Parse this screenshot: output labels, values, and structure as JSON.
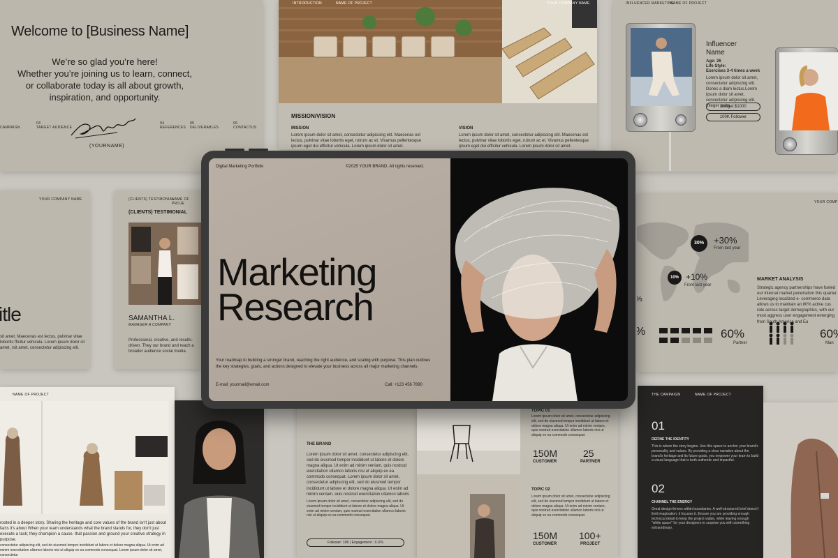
{
  "welcome": {
    "title": "Welcome to [Business Name]",
    "lines": [
      "We’re so glad you’re here!",
      "Whether you’re joining us to learn, connect,",
      "or collaborate  today is all about growth,",
      "inspiration, and opportunity."
    ],
    "signature": "Signature",
    "yourname": "(YOURNAME)",
    "nav": [
      {
        "num": "",
        "label": "CAMPAIGN"
      },
      {
        "num": "03",
        "label": "TARGET AUDIENCE"
      },
      {
        "num": "04",
        "label": "REFERENCES"
      },
      {
        "num": "05",
        "label": "DELIVERABLES"
      },
      {
        "num": "06",
        "label": "CONTACTUS"
      }
    ]
  },
  "mission": {
    "header_left": "INTRODUCTION",
    "header_mid": "NAME OF PROJECT",
    "header_right": "YOUR COMPANY NAME",
    "title": "MISSION/VISION",
    "col1_title": "MISSION",
    "col2_title": "VISION",
    "body": "Lorem ipsum dolor sit amet, consectetur adipiscing elit. Maecenas est lectus, pulvinar vitae lobortis eget, rutrum ac et. Vivamus pellentesque ipsum eget dui efficitur vehicula. Lorem ipsum dolor sit amet."
  },
  "influencer": {
    "header_left": "INFLUENCER MARKETING",
    "header_mid": "NAME OF PROJECT",
    "title": "Influencer Name",
    "age": "Age: 26",
    "lifestyle": "Life Style:",
    "exercise": "Exercises 3-4 times a week",
    "body": "Lorem ipsum dolor sit amet, consectetur adipiscing elit. Donec a diam lectus.Lorem ipsum dolor sit amet, consectetur adipiscing elit. Integer porta.",
    "budget": "Budget:$1000",
    "followers": "100K Follower"
  },
  "company_left": {
    "header": "YOUR COMPANY NAME",
    "title": "itle",
    "body": "sit amet, Maecenas est lectus, pulvinar vitae lobortis fficitur vehicula. Lorem ipsum dolor sit amet, rsit amet, consectetur adipiscing elit."
  },
  "testimonial": {
    "header_left": "(CLIENTS) TESTIMONIAL",
    "header_mid": "NAME OF PROJE",
    "title": "(CLIENTS) TESTIMONIAL",
    "name": "SAMANTHA L.",
    "role": "MANAGER A COMPANY",
    "body": "Professional, creative, and results-driven. They our brand and reach a broader audience social media."
  },
  "market": {
    "header": "YOUR COMP",
    "stat1_badge": "30%",
    "stat1_value": "+30%",
    "stat1_label": "From last year",
    "stat2_badge": "10%",
    "stat2_value": "+10%",
    "stat2_label": "From last year",
    "left_pct": "%",
    "left_pct2": "%",
    "title": "MARKET ANALYSIS",
    "body": "Strategic agency partnerships have fueled our internat market penetration this quarter. Leveraging localized e- commerce data allows us to maintain an 80% active cus rate across target demographics, with our most aggress user engagement emerging from South America and Ea",
    "partner_pct": "60%",
    "partner_label": "Partner",
    "man_pct": "60%",
    "man_label": "Man"
  },
  "story": {
    "header": "NAME OF PROJECT",
    "body1": "rooted in a deeper story. Sharing the heritage and core values of the brand isn't just about facts it's about When your team understands what the brand stands for, they don't just execute a task; they champion a cause. that passion and ground your creative strategy in purpose.",
    "body2": "consectetur adipiscing elit, sed do eiusmod tempor incididunt ut labore et dolore magna aliqua. Ut enim ad minim iexercitation ullamco laboris nisi ut aliquip ex ea commodo consequat. Lorem ipsum dolor sit amet, consectetur"
  },
  "brand": {
    "title": "THE BRAND",
    "body1": "Lorem ipsum dolor sit amet, consectetur adipiscing elit, sed do eiusmod tempor incididunt ut labore et dolore magna aliqua. Ut enim ad minim veniam, quis nostrud exercitation ullamco laboris nisi ut aliquip ex ea commodo consequat. Lorem ipsum dolor sit amet, consectetur adipiscing elit, sed do eiusmod tempor incididunt ut labore et dolore magna aliqua. Ut enim ad minim veniam, quis nostrud exercitation ullamco laboris nisi.",
    "body2": "Lorem ipsum dolor sit amet, consectetur adipiscing elit, sed do eiusmod tempor incididunt ut labore et dolore magna aliqua. Ut enim ad minim veniam, quis nostrud exercitation ullamco laboris nisi ut aliquip ex ea commodo consequat.",
    "pill": "Follower: 10K | Engagement : X.X%"
  },
  "topics": {
    "topic1": "TOPIC 01",
    "topic2": "TOPIC 02",
    "body": "Lorem ipsum dolor sit amet, consectetur adipiscing elit, sed do eiusmod tempor incididunt ut labore et dolore magna aliqua. Ut enim ad minim veniam, quis nostrud exercitation ullamco laboris nisi ut aliquip ex ea commodo consequat.",
    "n1": "150M",
    "l1": "CUSTOMER",
    "n2": "25",
    "l2": "PARTNER",
    "n3": "150M",
    "l3": "CUSTOMER",
    "n4": "100+",
    "l4": "PROJECT"
  },
  "campaign": {
    "header_left": "THE CAMPAIGN",
    "header_mid": "NAME OF PROJECT",
    "num1": "01",
    "title1": "DEFINE THE IDENTITY",
    "body1": "This is where the story begins. Use this space to anchor your brand's personality and values. By providing a clear narrative about the brand's heritage and its future goals, you empower your team to build a visual language that is both authentic and impactful.",
    "num2": "02",
    "title2": "CHANNEL THE ENERGY",
    "body2": "Great design thrives within boundaries. A well-structured brief doesn't limit imagination; it focuses it. Ensure you are providing enough technical detail to keep the project viable, while leaving enough \"white space\" for your designers to surprise you with something extraordinary."
  },
  "hero": {
    "portfolio": "Digital Marketing Portfolio",
    "copyright": "©2025 YOUR BRAND. All rights reserved.",
    "title_line1": "Marketing",
    "title_line2": "Research",
    "description": "Your roadmap to building a stronger brand, reaching the right audience, and scaling with purpose. This plan outlines the key strategies, goals, and actions designed to elevate your business across all major marketing channels.",
    "email": "E-mail: yourmail@email.com",
    "phone": "Call: +123 456 7890"
  }
}
